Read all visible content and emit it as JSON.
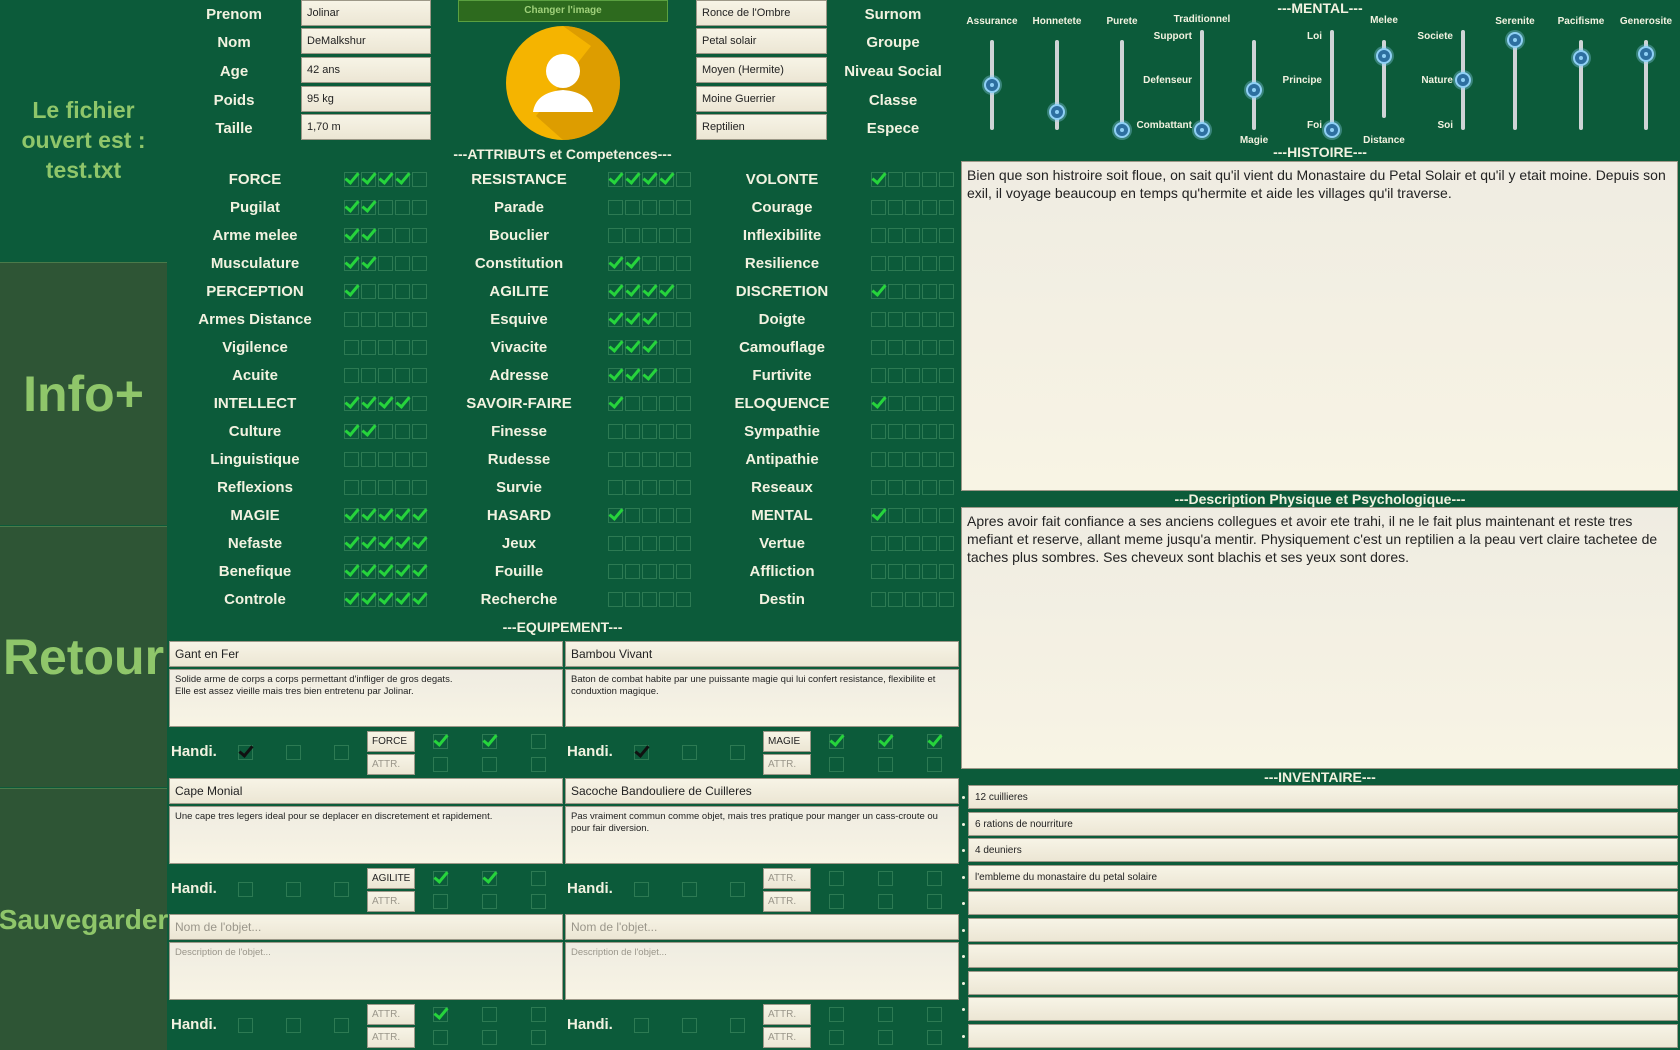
{
  "sidebar": {
    "file_info": "Le fichier ouvert est : test.txt",
    "info_button": "Info+",
    "back_button": "Retour",
    "save_button": "Sauvegarder"
  },
  "identity_left": [
    {
      "label": "Prenom",
      "value": "Jolinar"
    },
    {
      "label": "Nom",
      "value": "DeMalkshur"
    },
    {
      "label": "Age",
      "value": "42 ans"
    },
    {
      "label": "Poids",
      "value": "95 kg"
    },
    {
      "label": "Taille",
      "value": "1,70 m"
    }
  ],
  "identity_right": [
    {
      "label": "Surnom",
      "value": "Ronce de l'Ombre"
    },
    {
      "label": "Groupe",
      "value": "Petal solair"
    },
    {
      "label": "Niveau Social",
      "value": "Moyen (Hermite)"
    },
    {
      "label": "Classe",
      "value": "Moine Guerrier"
    },
    {
      "label": "Espece",
      "value": "Reptilien"
    }
  ],
  "avatar": {
    "change_button": "Changer l'image",
    "icon": "user-avatar-icon",
    "color": "#f5b400"
  },
  "attributes": {
    "title": "---ATTRIBUTS et Competences---",
    "columns": [
      [
        {
          "label": "FORCE",
          "level": 4
        },
        {
          "label": "Pugilat",
          "level": 2
        },
        {
          "label": "Arme melee",
          "level": 2
        },
        {
          "label": "Musculature",
          "level": 2
        },
        {
          "label": "PERCEPTION",
          "level": 1
        },
        {
          "label": "Armes Distance",
          "level": 0
        },
        {
          "label": "Vigilence",
          "level": 0
        },
        {
          "label": "Acuite",
          "level": 0
        },
        {
          "label": "INTELLECT",
          "level": 4
        },
        {
          "label": "Culture",
          "level": 2
        },
        {
          "label": "Linguistique",
          "level": 0
        },
        {
          "label": "Reflexions",
          "level": 0
        },
        {
          "label": "MAGIE",
          "level": 5
        },
        {
          "label": "Nefaste",
          "level": 5
        },
        {
          "label": "Benefique",
          "level": 5
        },
        {
          "label": "Controle",
          "level": 5
        }
      ],
      [
        {
          "label": "RESISTANCE",
          "level": 4
        },
        {
          "label": "Parade",
          "level": 0
        },
        {
          "label": "Bouclier",
          "level": 0
        },
        {
          "label": "Constitution",
          "level": 2
        },
        {
          "label": "AGILITE",
          "level": 4
        },
        {
          "label": "Esquive",
          "level": 3
        },
        {
          "label": "Vivacite",
          "level": 3
        },
        {
          "label": "Adresse",
          "level": 3
        },
        {
          "label": "SAVOIR-FAIRE",
          "level": 1
        },
        {
          "label": "Finesse",
          "level": 0
        },
        {
          "label": "Rudesse",
          "level": 0
        },
        {
          "label": "Survie",
          "level": 0
        },
        {
          "label": "HASARD",
          "level": 1
        },
        {
          "label": "Jeux",
          "level": 0
        },
        {
          "label": "Fouille",
          "level": 0
        },
        {
          "label": "Recherche",
          "level": 0
        }
      ],
      [
        {
          "label": "VOLONTE",
          "level": 1
        },
        {
          "label": "Courage",
          "level": 0
        },
        {
          "label": "Inflexibilite",
          "level": 0
        },
        {
          "label": "Resilience",
          "level": 0
        },
        {
          "label": "DISCRETION",
          "level": 1
        },
        {
          "label": "Doigte",
          "level": 0
        },
        {
          "label": "Camouflage",
          "level": 0
        },
        {
          "label": "Furtivite",
          "level": 0
        },
        {
          "label": "ELOQUENCE",
          "level": 1
        },
        {
          "label": "Sympathie",
          "level": 0
        },
        {
          "label": "Antipathie",
          "level": 0
        },
        {
          "label": "Reseaux",
          "level": 0
        },
        {
          "label": "MENTAL",
          "level": 1
        },
        {
          "label": "Vertue",
          "level": 0
        },
        {
          "label": "Affliction",
          "level": 0
        },
        {
          "label": "Destin",
          "level": 0
        }
      ]
    ]
  },
  "equipment": {
    "title": "---EQUIPEMENT---",
    "handi_label": "Handi.",
    "attr_placeholder": "ATTR.",
    "name_placeholder": "Nom de l'objet...",
    "desc_placeholder": "Description de l'objet...",
    "items": [
      {
        "name": "Gant en Fer",
        "desc": "Solide arme de corps a corps permettant d'infliger de gros degats.\nElle est assez vieille mais tres bien entretenu par Jolinar.",
        "handi": [
          true,
          false,
          false
        ],
        "attr1": "FORCE",
        "attr1_checks": [
          true,
          true,
          false
        ],
        "attr2": "",
        "attr2_checks": [
          false,
          false,
          false
        ]
      },
      {
        "name": "Bambou Vivant",
        "desc": "Baton de combat habite par une puissante magie qui lui confert resistance, flexibilite et conduxtion magique.",
        "handi": [
          true,
          false,
          false
        ],
        "attr1": "MAGIE",
        "attr1_checks": [
          true,
          true,
          true
        ],
        "attr2": "",
        "attr2_checks": [
          false,
          false,
          false
        ]
      },
      {
        "name": "Cape Monial",
        "desc": "Une cape tres legers ideal pour se deplacer en discretement et rapidement.",
        "handi": [
          false,
          false,
          false
        ],
        "attr1": "AGILITE",
        "attr1_checks": [
          true,
          true,
          false
        ],
        "attr2": "",
        "attr2_checks": [
          false,
          false,
          false
        ]
      },
      {
        "name": "Sacoche Bandouliere de Cuilleres",
        "desc": "Pas vraiment commun comme objet, mais tres pratique pour manger un cass-croute ou pour fair diversion.",
        "handi": [
          false,
          false,
          false
        ],
        "attr1": "",
        "attr1_checks": [
          false,
          false,
          false
        ],
        "attr2": "",
        "attr2_checks": [
          false,
          false,
          false
        ]
      },
      {
        "name": "",
        "desc": "",
        "handi": [
          false,
          false,
          false
        ],
        "attr1": "",
        "attr1_checks": [
          true,
          false,
          false
        ],
        "attr2": "",
        "attr2_checks": [
          false,
          false,
          false
        ]
      },
      {
        "name": "",
        "desc": "",
        "handi": [
          false,
          false,
          false
        ],
        "attr1": "",
        "attr1_checks": [
          false,
          false,
          false
        ],
        "attr2": "",
        "attr2_checks": [
          false,
          false,
          false
        ]
      }
    ]
  },
  "mental": {
    "title": "---MENTAL---",
    "sliders": [
      {
        "label": "Assurance",
        "value": 0.5
      },
      {
        "label": "Honnetete",
        "value": 0.2
      },
      {
        "label": "Purete",
        "value": 0.0
      },
      {
        "label": "Traditionnel",
        "top": "Support",
        "mid": "Defenseur",
        "bottom": "Combattant",
        "value": 0.0
      },
      {
        "label": "",
        "bottom": "Magie",
        "value": 0.45
      },
      {
        "label": "",
        "top": "Loi",
        "mid": "Principe",
        "bottom": "Foi",
        "value": 0.0
      },
      {
        "label": "Melee",
        "bottom": "Distance",
        "value": 0.8
      },
      {
        "label": "",
        "top": "Societe",
        "mid": "Nature",
        "bottom": "Soi",
        "value": 0.5
      },
      {
        "label": "Serenite",
        "value": 1.0
      },
      {
        "label": "Pacifisme",
        "value": 0.8
      },
      {
        "label": "Generosite",
        "value": 0.85
      }
    ]
  },
  "histoire": {
    "title": "---HISTOIRE---",
    "text": "Bien que son histroire soit floue, on sait qu'il vient du Monastaire du Petal Solair et qu'il y etait moine. Depuis son exil, il voyage beaucoup en temps qu'hermite et aide les villages qu'il traverse."
  },
  "description": {
    "title": "---Description Physique et Psychologique---",
    "text": "Apres avoir fait confiance a ses anciens collegues et avoir ete trahi, il ne le fait plus maintenant et reste tres mefiant et reserve, allant meme jusqu'a mentir. Physiquement c'est un reptilien a la peau vert claire tachetee de taches plus sombres. Ses cheveux sont blachis et ses yeux sont dores."
  },
  "inventaire": {
    "title": "---INVENTAIRE---",
    "items": [
      "12 cuillieres",
      "6 rations de nourriture",
      "4 deuniers",
      "l'embleme du monastaire du petal solaire",
      "",
      "",
      "",
      "",
      "",
      ""
    ]
  }
}
